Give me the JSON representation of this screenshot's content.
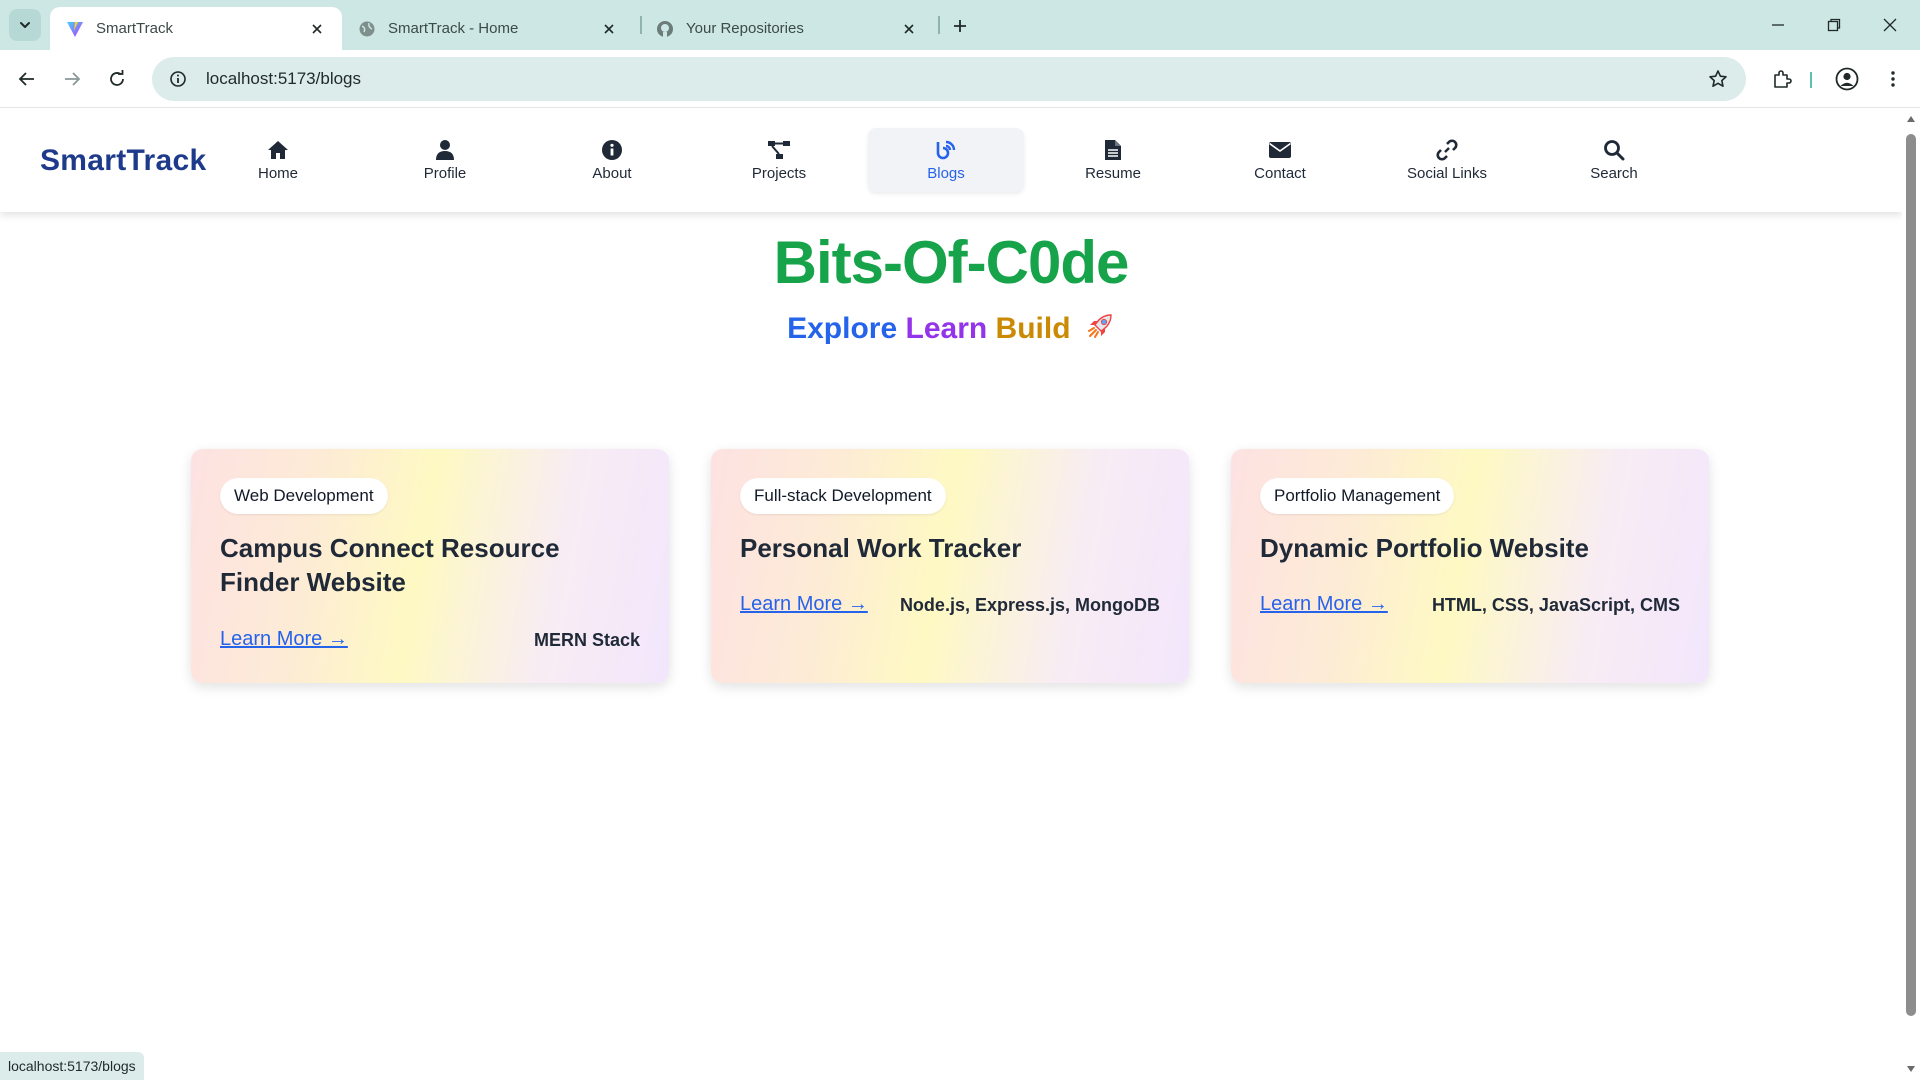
{
  "browser": {
    "tabs": [
      {
        "title": "SmartTrack",
        "active": true,
        "favicon": "vite-icon"
      },
      {
        "title": "SmartTrack - Home",
        "active": false,
        "favicon": "globe-icon"
      },
      {
        "title": "Your Repositories",
        "active": false,
        "favicon": "github-icon"
      }
    ],
    "url": "localhost:5173/blogs",
    "status_text": "localhost:5173/blogs"
  },
  "navbar": {
    "brand": "SmartTrack",
    "items": [
      {
        "label": "Home",
        "icon": "home-icon",
        "active": false
      },
      {
        "label": "Profile",
        "icon": "user-icon",
        "active": false
      },
      {
        "label": "About",
        "icon": "info-icon",
        "active": false
      },
      {
        "label": "Projects",
        "icon": "project-diagram-icon",
        "active": false
      },
      {
        "label": "Blogs",
        "icon": "blog-icon",
        "active": true
      },
      {
        "label": "Resume",
        "icon": "file-icon",
        "active": false
      },
      {
        "label": "Contact",
        "icon": "envelope-icon",
        "active": false
      },
      {
        "label": "Social Links",
        "icon": "link-icon",
        "active": false
      },
      {
        "label": "Search",
        "icon": "search-icon",
        "active": false
      }
    ],
    "active_color": "#2563eb"
  },
  "hero": {
    "title": "Bits-Of-C0de",
    "subtitle_words": [
      "Explore",
      "Learn",
      "Build"
    ],
    "subtitle_emoji": "rocket-icon"
  },
  "cards": [
    {
      "tag": "Web Development",
      "title": "Campus Connect Resource Finder Website",
      "link": "Learn More →",
      "tech": "MERN Stack"
    },
    {
      "tag": "Full-stack Development",
      "title": "Personal Work Tracker",
      "link": "Learn More →",
      "tech": "Node.js, Express.js, MongoDB"
    },
    {
      "tag": "Portfolio Management",
      "title": "Dynamic Portfolio Website",
      "link": "Learn More →",
      "tech": "HTML, CSS, JavaScript, CMS"
    }
  ],
  "colors": {
    "brand": "#1e3a8a",
    "hero_title": "#16a34a",
    "explore": "#2563eb",
    "learn": "#9333ea",
    "build": "#ca8a04",
    "link": "#2563eb"
  }
}
